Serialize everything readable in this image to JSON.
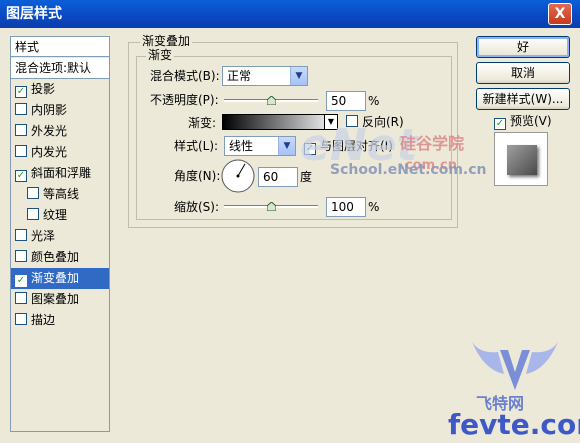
{
  "window": {
    "title": "图层样式",
    "close_label": "X"
  },
  "styles_panel": {
    "header": "样式",
    "blend_options": "混合选项:默认",
    "items": [
      {
        "label": "投影",
        "checked": true,
        "indent": false,
        "selected": false
      },
      {
        "label": "内阴影",
        "checked": false,
        "indent": false,
        "selected": false
      },
      {
        "label": "外发光",
        "checked": false,
        "indent": false,
        "selected": false
      },
      {
        "label": "内发光",
        "checked": false,
        "indent": false,
        "selected": false
      },
      {
        "label": "斜面和浮雕",
        "checked": true,
        "indent": false,
        "selected": false
      },
      {
        "label": "等高线",
        "checked": false,
        "indent": true,
        "selected": false
      },
      {
        "label": "纹理",
        "checked": false,
        "indent": true,
        "selected": false
      },
      {
        "label": "光泽",
        "checked": false,
        "indent": false,
        "selected": false
      },
      {
        "label": "颜色叠加",
        "checked": false,
        "indent": false,
        "selected": false
      },
      {
        "label": "渐变叠加",
        "checked": true,
        "indent": false,
        "selected": true
      },
      {
        "label": "图案叠加",
        "checked": false,
        "indent": false,
        "selected": false
      },
      {
        "label": "描边",
        "checked": false,
        "indent": false,
        "selected": false
      }
    ]
  },
  "gradient_overlay": {
    "group_title": "渐变叠加",
    "subgroup_title": "渐变",
    "blend_mode_label": "混合模式(B):",
    "blend_mode_value": "正常",
    "opacity_label": "不透明度(P):",
    "opacity_value": "50",
    "opacity_unit": "%",
    "opacity_level": 0.5,
    "gradient_label": "渐变:",
    "reverse_label": "反向(R)",
    "reverse_checked": false,
    "style_label": "样式(L):",
    "style_value": "线性",
    "align_label": "与图层对齐(I)",
    "align_checked": true,
    "angle_label": "角度(N):",
    "angle_value": "60",
    "angle_unit": "度",
    "scale_label": "缩放(S):",
    "scale_value": "100",
    "scale_unit": "%",
    "scale_level": 0.5
  },
  "buttons": {
    "ok": "好",
    "cancel": "取消",
    "new_style": "新建样式(W)...",
    "preview_label": "预览(V)",
    "preview_checked": true
  },
  "watermarks": {
    "site_cn": "硅谷学院",
    "site_dotcom": ".com.cn",
    "logo_text": "eNet",
    "site_url": "School.eNet.com.cn",
    "brand_cn": "飞特网",
    "brand_url": "fevte.com"
  },
  "colors": {
    "title_bar": "#0a48c0",
    "selection": "#316ac5",
    "dialog_bg": "#ece9d8",
    "check": "#21a121"
  }
}
